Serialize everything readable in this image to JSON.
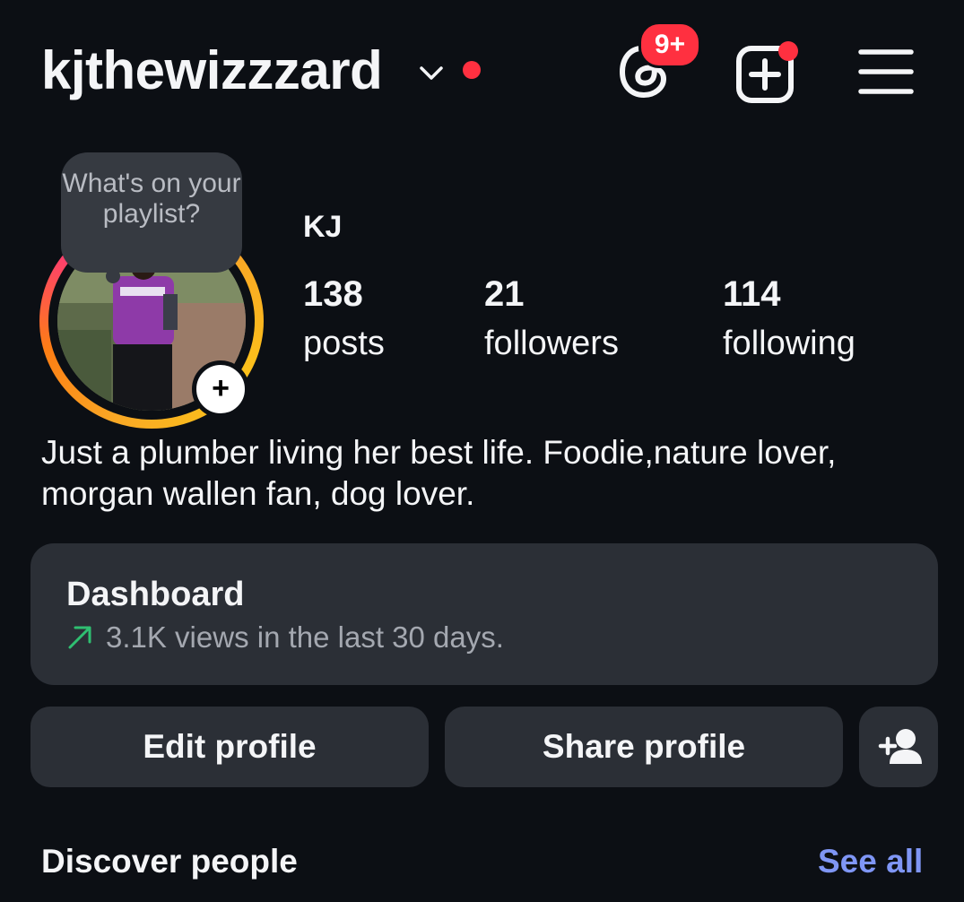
{
  "header": {
    "username": "kjthewizzzard",
    "threads_badge": "9+"
  },
  "profile": {
    "note": "What's on your playlist?",
    "display_name": "KJ",
    "stats": [
      {
        "value": "138",
        "label": "posts"
      },
      {
        "value": "21",
        "label": "followers"
      },
      {
        "value": "114",
        "label": "following"
      }
    ],
    "bio_line1": "Just a plumber living her best life. Foodie,nature lover,",
    "bio_line2": "morgan wallen fan, dog lover."
  },
  "dashboard": {
    "title": "Dashboard",
    "subtitle": "3.1K views in the last 30 days."
  },
  "actions": {
    "edit": "Edit profile",
    "share": "Share profile"
  },
  "discover": {
    "title": "Discover people",
    "see_all": "See all"
  },
  "colors": {
    "background": "#0c0f14",
    "card": "#2b2f36",
    "notification_red": "#ff3040",
    "link_blue": "#7f96f5",
    "trend_green": "#2fbf71"
  },
  "icons": [
    "chevron-down-icon",
    "threads-icon",
    "create-post-icon",
    "hamburger-menu-icon",
    "trend-up-icon",
    "add-person-icon",
    "add-story-plus-icon"
  ]
}
